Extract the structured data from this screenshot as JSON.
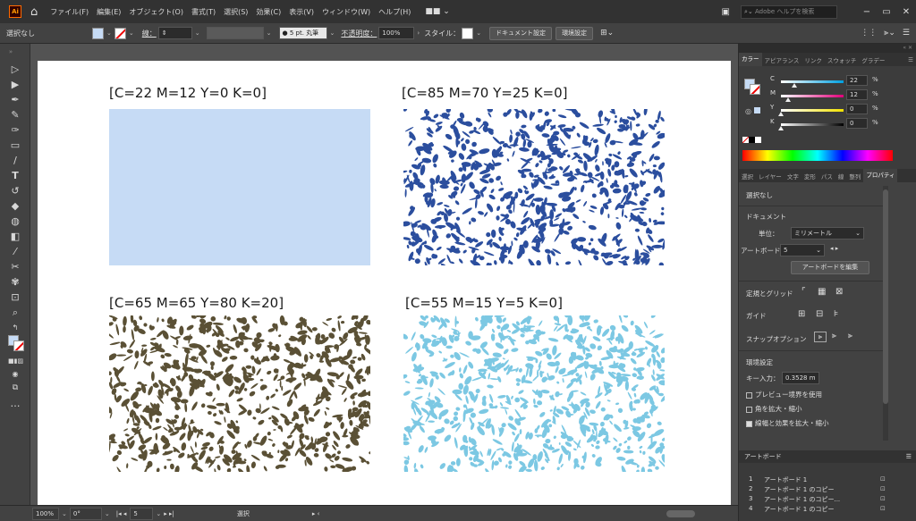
{
  "menubar": {
    "logo": "Ai",
    "menus": [
      "ファイル(F)",
      "編集(E)",
      "オブジェクト(O)",
      "書式(T)",
      "選択(S)",
      "効果(C)",
      "表示(V)",
      "ウィンドウ(W)",
      "ヘルプ(H)"
    ],
    "workspace_icon": "■■ ⌄",
    "search_placeholder": "Adobe ヘルプを検索",
    "minimize": "−",
    "restore": "▭",
    "close": "✕"
  },
  "controlbar": {
    "selection": "選択なし",
    "stroke_label": "線：",
    "stroke_size": "5 pt. 丸筆",
    "opacity_label": "不透明度：",
    "opacity_value": "100%",
    "style_label": "スタイル：",
    "document_setup": "ドキュメント設定",
    "preferences": "環境設定"
  },
  "artboard": {
    "swatches": [
      {
        "label": "[C=22 M=12 Y=0 K=0]",
        "color": "#c6dbf5",
        "type": "solid"
      },
      {
        "label": "[C=85 M=70 Y=25 K=0]",
        "color": "#2b4e9e",
        "type": "texture"
      },
      {
        "label": "[C=65 M=65 Y=80 K=20]",
        "color": "#5a5035",
        "type": "texture"
      },
      {
        "label": "[C=55 M=15 Y=5 K=0]",
        "color": "#7cc8e3",
        "type": "texture"
      }
    ]
  },
  "color_panel": {
    "tabs": [
      "カラー",
      "アピアランス",
      "リンク",
      "スウォッチ",
      "グラデー"
    ],
    "channels": [
      {
        "name": "C",
        "value": "22",
        "fraction": 0.22,
        "color": "#00a0e0"
      },
      {
        "name": "M",
        "value": "12",
        "fraction": 0.12,
        "color": "#e0007a"
      },
      {
        "name": "Y",
        "value": "0",
        "fraction": 0.0,
        "color": "#f2e200"
      },
      {
        "name": "K",
        "value": "0",
        "fraction": 0.0,
        "color": "#000000"
      }
    ],
    "percent": "%"
  },
  "properties_panel": {
    "tabs": [
      "選択",
      "レイヤー",
      "文字",
      "変形",
      "パス",
      "線",
      "整列",
      "プロパティ"
    ],
    "selection": "選択なし",
    "document_heading": "ドキュメント",
    "units_label": "単位：",
    "units_value": "ミリメートル",
    "artboard_label": "アートボード：",
    "artboard_value": "5",
    "edit_artboards": "アートボードを編集",
    "rulers_grids": "定規とグリッド",
    "guides": "ガイド",
    "snap_options": "スナップオプション",
    "preferences_heading": "環境設定",
    "keyboard_increment_label": "キー入力：",
    "keyboard_increment_value": "0.3528 m",
    "use_preview_bounds": "プレビュー境界を使用",
    "scale_corners": "角を拡大・縮小",
    "scale_strokes": "線幅と効果を拡大・縮小"
  },
  "artboards_panel": {
    "title": "アートボード",
    "rows": [
      {
        "num": "1",
        "name": "アートボード 1"
      },
      {
        "num": "2",
        "name": "アートボード 1 のコピー"
      },
      {
        "num": "3",
        "name": "アートボード 1 のコピー..."
      },
      {
        "num": "4",
        "name": "アートボード 1 のコピー"
      }
    ]
  },
  "statusbar": {
    "zoom": "100%",
    "rotation": "0°",
    "artboard_num": "5",
    "tool": "選択"
  }
}
